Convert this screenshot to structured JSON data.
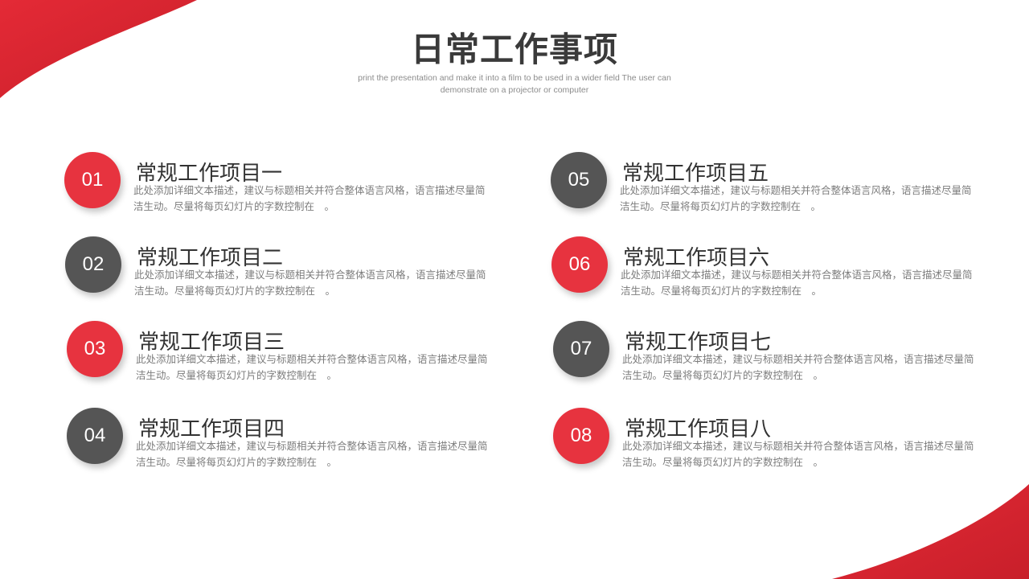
{
  "header": {
    "title": "日常工作事项",
    "subtitle": "print the presentation and make it into a film to be used in a wider field The user can demonstrate on a projector or computer"
  },
  "colors": {
    "accent": "#e7333f",
    "dark": "#555555"
  },
  "items": [
    {
      "number": "01",
      "title": "常规工作项目一",
      "description": "此处添加详细文本描述，建议与标题相关并符合整体语言风格，语言描述尽量简洁生动。尽量将每页幻灯片的字数控制在　。",
      "color": "red"
    },
    {
      "number": "02",
      "title": "常规工作项目二",
      "description": "此处添加详细文本描述，建议与标题相关并符合整体语言风格，语言描述尽量简洁生动。尽量将每页幻灯片的字数控制在　。",
      "color": "gray"
    },
    {
      "number": "03",
      "title": "常规工作项目三",
      "description": "此处添加详细文本描述，建议与标题相关并符合整体语言风格，语言描述尽量简洁生动。尽量将每页幻灯片的字数控制在　。",
      "color": "red"
    },
    {
      "number": "04",
      "title": "常规工作项目四",
      "description": "此处添加详细文本描述，建议与标题相关并符合整体语言风格，语言描述尽量简洁生动。尽量将每页幻灯片的字数控制在　。",
      "color": "gray"
    },
    {
      "number": "05",
      "title": "常规工作项目五",
      "description": "此处添加详细文本描述，建议与标题相关并符合整体语言风格，语言描述尽量简洁生动。尽量将每页幻灯片的字数控制在　。",
      "color": "gray"
    },
    {
      "number": "06",
      "title": "常规工作项目六",
      "description": "此处添加详细文本描述，建议与标题相关并符合整体语言风格，语言描述尽量简洁生动。尽量将每页幻灯片的字数控制在　。",
      "color": "red"
    },
    {
      "number": "07",
      "title": "常规工作项目七",
      "description": "此处添加详细文本描述，建议与标题相关并符合整体语言风格，语言描述尽量简洁生动。尽量将每页幻灯片的字数控制在　。",
      "color": "gray"
    },
    {
      "number": "08",
      "title": "常规工作项目八",
      "description": "此处添加详细文本描述，建议与标题相关并符合整体语言风格，语言描述尽量简洁生动。尽量将每页幻灯片的字数控制在　。",
      "color": "red"
    }
  ]
}
